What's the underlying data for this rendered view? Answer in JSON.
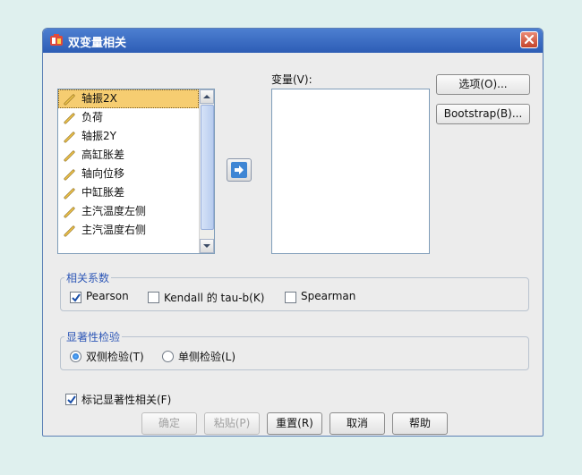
{
  "window": {
    "title": "双变量相关",
    "close_icon": "close-icon",
    "app_icon": "spss-icon"
  },
  "source_list": {
    "items": [
      {
        "label": "轴振2X",
        "selected": true
      },
      {
        "label": "负荷",
        "selected": false
      },
      {
        "label": "轴振2Y",
        "selected": false
      },
      {
        "label": "高缸胀差",
        "selected": false
      },
      {
        "label": "轴向位移",
        "selected": false
      },
      {
        "label": "中缸胀差",
        "selected": false
      },
      {
        "label": "主汽温度左侧",
        "selected": false
      },
      {
        "label": "主汽温度右侧",
        "selected": false
      }
    ],
    "item_icon": "scale-variable-icon"
  },
  "variables": {
    "label": "变量(V):",
    "items": []
  },
  "side_buttons": {
    "options": "选项(O)...",
    "bootstrap": "Bootstrap(B)..."
  },
  "correlation": {
    "legend": "相关系数",
    "pearson": "Pearson",
    "kendall": "Kendall 的 tau-b(K)",
    "spearman": "Spearman",
    "pearson_checked": true,
    "kendall_checked": false,
    "spearman_checked": false
  },
  "significance": {
    "legend": "显著性检验",
    "two_tailed": "双侧检验(T)",
    "one_tailed": "单侧检验(L)",
    "selected": "two_tailed"
  },
  "flag": {
    "label": "标记显著性相关(F)",
    "checked": true
  },
  "buttons": {
    "ok": "确定",
    "paste": "粘贴(P)",
    "reset": "重置(R)",
    "cancel": "取消",
    "help": "帮助"
  },
  "colors": {
    "title_bar": "#2d5db5",
    "legend_text": "#2f58b7",
    "selection": "#f6cd71"
  }
}
